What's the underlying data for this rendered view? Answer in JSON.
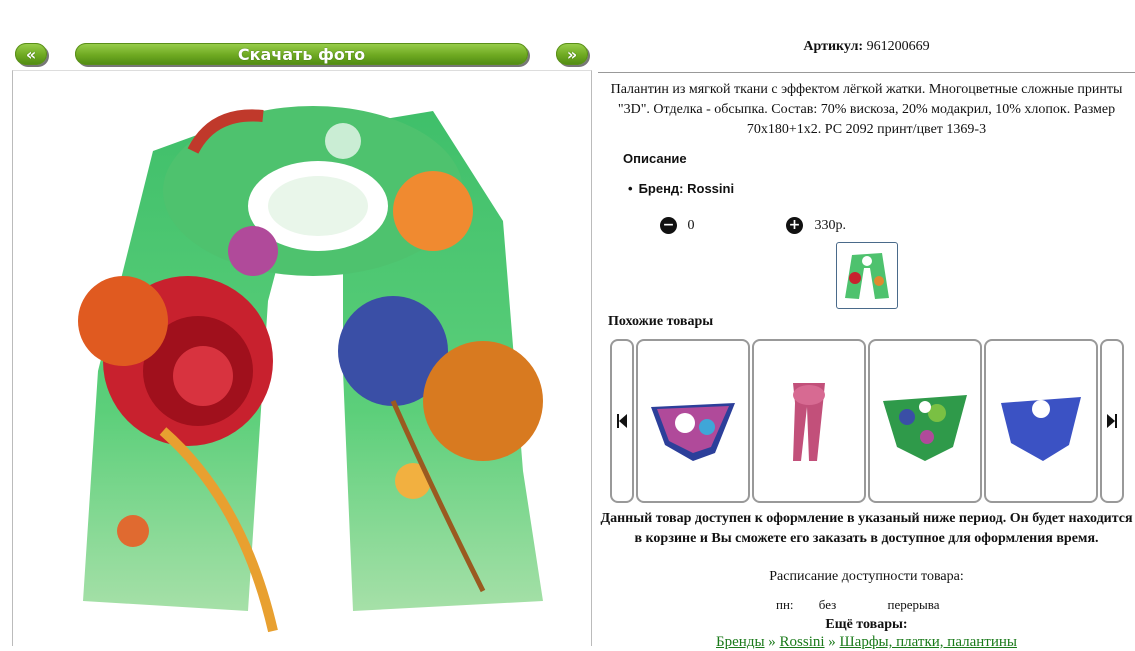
{
  "photo_nav": {
    "prev_label": "«",
    "download_label": "Скачать фото",
    "next_label": "»"
  },
  "product": {
    "article_label": "Артикул:",
    "article_value": "961200669",
    "description": "Палантин из мягкой ткани с эффектом лёгкой жатки. Многоцветные сложные принты \"3D\". Отделка - обсыпка. Состав: 70% вискоза, 20% модакрил, 10% хлопок. Размер 70х180+1х2. РС 2092 принт/цвет 1369-3",
    "section_title": "Описание",
    "brand_line": "Бренд: Rossini",
    "quantity": "0",
    "price": "330р.",
    "minus_icon": "minus-circle-icon",
    "plus_icon": "plus-circle-icon"
  },
  "similar": {
    "title": "Похожие товары",
    "prev_icon": "skip-back-icon",
    "next_icon": "skip-forward-icon"
  },
  "availability": {
    "notice": "Данный товар доступен к оформление в указаный ниже период. Он будет находится в корзине и Вы сможете его заказать в доступное для оформления время.",
    "schedule_title": "Расписание доступности товара:",
    "day": "пн:",
    "from": "без",
    "to": "перерыва"
  },
  "more": {
    "title": "Ещё товары:",
    "crumb1": "Бренды",
    "sep1": " » ",
    "crumb2": "Rossini",
    "sep2": " » ",
    "crumb3": "Шарфы, платки, палантины"
  },
  "colors": {
    "button_green": "#6ea921",
    "link_green": "#1a7a1a",
    "border_gray": "#999999"
  }
}
